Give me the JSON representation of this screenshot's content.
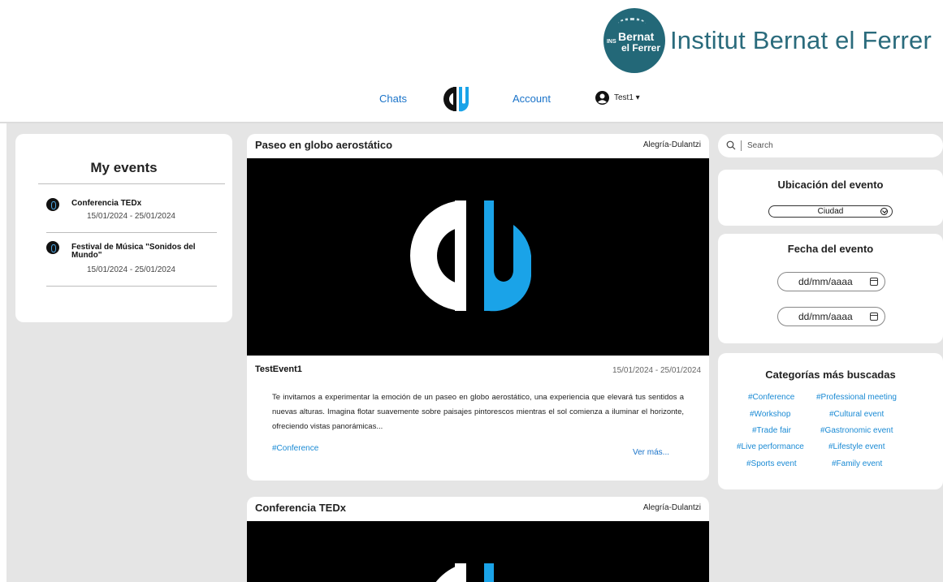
{
  "header": {
    "school_logo_text_ins": "INS",
    "school_logo_text_1": "Bernat",
    "school_logo_text_2": "el Ferrer",
    "school_name": "Institut Bernat el Ferrer"
  },
  "nav": {
    "chats": "Chats",
    "account": "Account",
    "user": "Test1 ▾",
    "logo_icon": "cu-logo-icon",
    "user_icon": "user-circle-icon"
  },
  "my_events": {
    "title": "My events",
    "items": [
      {
        "title": "Conferencia TEDx",
        "date": "15/01/2024 - 25/01/2024"
      },
      {
        "title": "Festival de Música \"Sonidos del Mundo\"",
        "date": "15/01/2024 - 25/01/2024"
      }
    ]
  },
  "feed": {
    "posts": [
      {
        "title": "Paseo en globo aerostático",
        "location": "Alegría-Dulantzi",
        "event_title": "TestEvent1",
        "event_date": "15/01/2024 - 25/01/2024",
        "description": "Te invitamos a experimentar la emoción de un paseo en globo aerostático, una experiencia que elevará tus sentidos a nuevas alturas. Imagina flotar suavemente sobre paisajes pintorescos mientras el sol comienza a iluminar el horizonte, ofreciendo vistas panorámicas...",
        "tag": "#Conference",
        "more": "Ver más..."
      },
      {
        "title": "Conferencia TEDx",
        "location": "Alegría-Dulantzi"
      }
    ]
  },
  "search": {
    "placeholder": "Search"
  },
  "filters": {
    "location_title": "Ubicación del evento",
    "city_select": "Ciudad",
    "date_title": "Fecha del evento",
    "date_placeholder_1": "dd/mm/aaaa",
    "date_placeholder_2": "dd/mm/aaaa"
  },
  "categories": {
    "title": "Categorías más buscadas",
    "tags": [
      "#Conference",
      "#Professional meeting",
      "#Workshop",
      "#Cultural event",
      "#Trade fair",
      "#Gastronomic event",
      "#Live performance",
      "#Lifestyle event",
      "#Sports event",
      "#Family event"
    ]
  },
  "colors": {
    "brand_blue": "#1a8ad4",
    "logo_blue": "#1aa3e8",
    "school_teal": "#236878",
    "panel_bg": "#e5e5e5"
  }
}
